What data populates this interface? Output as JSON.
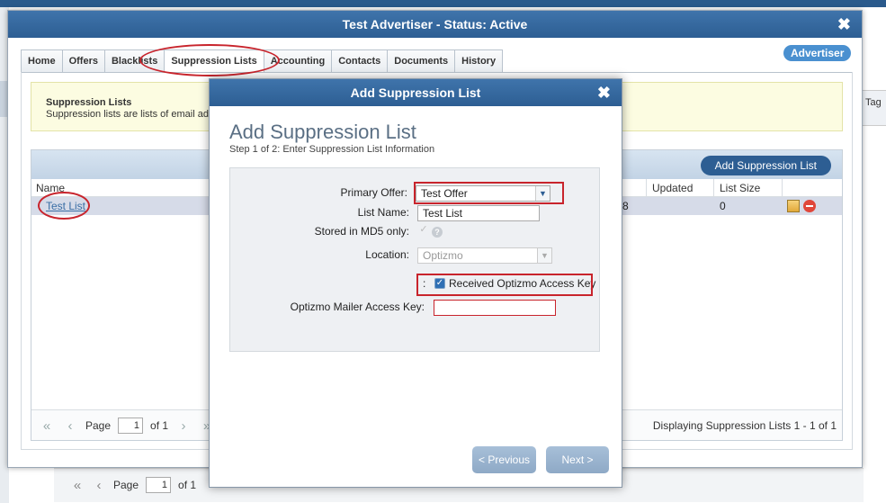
{
  "outer_window": {
    "title": "Test Advertiser - Status: Active",
    "close_glyph": "✖",
    "badge": "Advertiser",
    "tabs": [
      "Home",
      "Offers",
      "Blacklists",
      "Suppression Lists",
      "Accounting",
      "Contacts",
      "Documents",
      "History"
    ],
    "active_tab": "Suppression Lists",
    "info": {
      "title": "Suppression Lists",
      "description": "Suppression lists are lists of email ad"
    },
    "grid": {
      "add_button": "Add Suppression List",
      "columns": [
        "Name",
        "Updated",
        "List Size"
      ],
      "rows": [
        {
          "name": "Test List",
          "partial": "8",
          "list_size": "0"
        }
      ],
      "pager": {
        "page_label": "Page",
        "page": "1",
        "of_label": "of 1"
      },
      "display_text": "Displaying Suppression Lists 1 - 1 of 1"
    }
  },
  "background": {
    "right_column": "Tag",
    "pager": {
      "page_label": "Page",
      "page": "1",
      "of_label": "of 1"
    }
  },
  "modal": {
    "title": "Add Suppression List",
    "close_glyph": "✖",
    "heading": "Add Suppression List",
    "step": "Step 1 of 2: Enter Suppression List Information",
    "fields": {
      "primary_offer_label": "Primary Offer:",
      "primary_offer_value": "Test Offer",
      "list_name_label": "List Name:",
      "list_name_value": "Test List",
      "md5_label": "Stored in MD5 only:",
      "location_label": "Location:",
      "location_value": "Optizmo",
      "received_key_prefix": ":",
      "received_key_label": "Received Optizmo Access Key",
      "mailer_key_label": "Optizmo Mailer Access Key:",
      "mailer_key_value": ""
    },
    "buttons": {
      "previous": "< Previous",
      "next": "Next >"
    }
  },
  "colors": {
    "titlebar": "#2d5e93",
    "highlight": "#c8242c",
    "badge": "#4a90d0"
  }
}
